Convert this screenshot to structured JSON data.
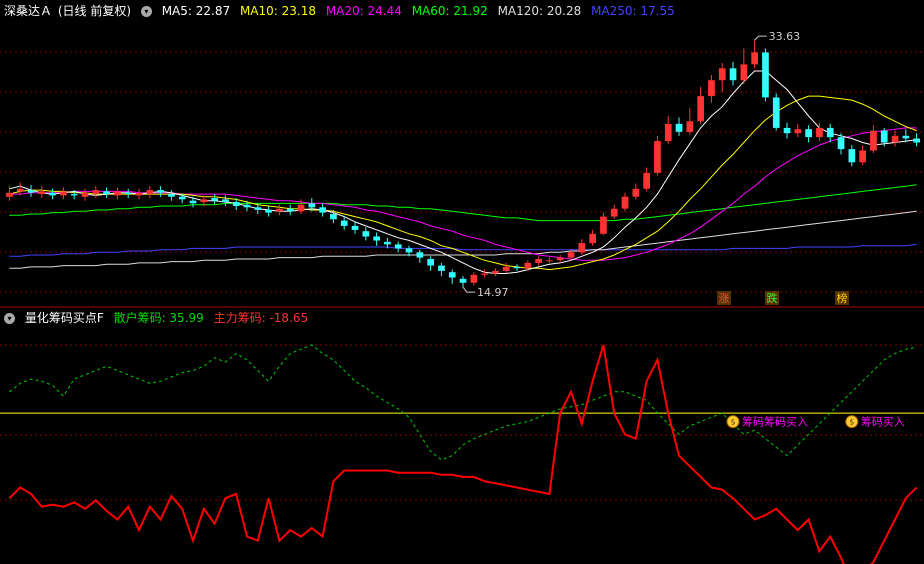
{
  "header_top": {
    "title": "深桑达Ａ",
    "period": "(日线 前复权)",
    "ma": [
      {
        "label": "MA5: 22.87",
        "color": "#ffffff"
      },
      {
        "label": "MA10: 23.18",
        "color": "#ffff00"
      },
      {
        "label": "MA20: 24.44",
        "color": "#ff00ff"
      },
      {
        "label": "MA60: 21.92",
        "color": "#00ff00"
      },
      {
        "label": "MA120: 20.28",
        "color": "#dddddd"
      },
      {
        "label": "MA250: 17.55",
        "color": "#4444ff"
      }
    ]
  },
  "header_bottom": {
    "title": "量化筹码买点F",
    "retail_label": "散户筹码: 35.99",
    "main_label": "主力筹码: -18.65"
  },
  "annotations": {
    "high": "33.63",
    "low": "14.97",
    "buy_label_1": "筹码筹码买入",
    "buy_label_2": "筹码买入"
  },
  "badges": [
    "涨",
    "跌",
    "榜"
  ],
  "colors": {
    "up": "#ff3333",
    "down": "#33ffff",
    "grid": "#8a0000",
    "divider": "#aa0000",
    "ma5": "#ffffff",
    "ma10": "#ffff00",
    "ma20": "#ff00ff",
    "ma60": "#00ff00",
    "ma120": "#dddddd",
    "ma250": "#4444ff",
    "retail": "#00cc00",
    "main": "#ff0000",
    "zero_line": "#ffff00",
    "buy_text": "#ff00ff"
  },
  "chart_data": [
    {
      "type": "candlestick",
      "name": "price",
      "ylim": [
        14,
        35
      ],
      "candles": [
        [
          21.8,
          22.1,
          22.6,
          21.5
        ],
        [
          22.2,
          22.4,
          22.9,
          21.9
        ],
        [
          22.3,
          22.1,
          22.7,
          21.8
        ],
        [
          22.0,
          22.2,
          22.6,
          21.7
        ],
        [
          22.1,
          21.9,
          22.4,
          21.6
        ],
        [
          21.9,
          22.2,
          22.5,
          21.6
        ],
        [
          22.0,
          21.9,
          22.3,
          21.6
        ],
        [
          21.8,
          22.1,
          22.4,
          21.5
        ],
        [
          22.0,
          22.3,
          22.6,
          21.7
        ],
        [
          22.2,
          22.0,
          22.5,
          21.7
        ],
        [
          21.9,
          22.2,
          22.5,
          21.6
        ],
        [
          22.1,
          22.0,
          22.4,
          21.7
        ],
        [
          21.9,
          22.1,
          22.4,
          21.6
        ],
        [
          22.0,
          22.3,
          22.6,
          21.7
        ],
        [
          22.3,
          22.1,
          22.6,
          21.8
        ],
        [
          22.0,
          21.8,
          22.3,
          21.5
        ],
        [
          21.8,
          21.6,
          22.0,
          21.3
        ],
        [
          21.5,
          21.3,
          21.8,
          21.0
        ],
        [
          21.4,
          21.6,
          21.9,
          21.1
        ],
        [
          21.7,
          21.5,
          22.0,
          21.2
        ],
        [
          21.6,
          21.4,
          21.9,
          21.1
        ],
        [
          21.4,
          21.1,
          21.7,
          20.8
        ],
        [
          21.2,
          21.0,
          21.5,
          20.7
        ],
        [
          21.0,
          20.8,
          21.3,
          20.5
        ],
        [
          20.8,
          20.6,
          21.1,
          20.3
        ],
        [
          20.7,
          20.9,
          21.2,
          20.4
        ],
        [
          20.9,
          20.7,
          21.2,
          20.4
        ],
        [
          20.7,
          21.2,
          21.6,
          20.5
        ],
        [
          21.3,
          21.0,
          21.7,
          20.7
        ],
        [
          21.0,
          20.6,
          21.3,
          20.3
        ],
        [
          20.5,
          20.1,
          20.8,
          19.8
        ],
        [
          20.0,
          19.6,
          20.3,
          19.3
        ],
        [
          19.6,
          19.3,
          19.9,
          19.0
        ],
        [
          19.2,
          18.8,
          19.5,
          18.5
        ],
        [
          18.8,
          18.5,
          19.1,
          18.1
        ],
        [
          18.4,
          18.2,
          18.7,
          17.9
        ],
        [
          18.2,
          17.9,
          18.4,
          17.6
        ],
        [
          17.9,
          17.6,
          18.1,
          17.3
        ],
        [
          17.6,
          17.2,
          17.8,
          16.8
        ],
        [
          17.1,
          16.6,
          17.3,
          16.2
        ],
        [
          16.6,
          16.2,
          16.8,
          15.8
        ],
        [
          16.1,
          15.7,
          16.3,
          15.2
        ],
        [
          15.6,
          15.3,
          15.8,
          14.97
        ],
        [
          15.3,
          15.9,
          16.1,
          15.1
        ],
        [
          15.9,
          16.0,
          16.3,
          15.7
        ],
        [
          16.0,
          16.2,
          16.4,
          15.8
        ],
        [
          16.2,
          16.5,
          16.8,
          16.0
        ],
        [
          16.5,
          16.4,
          16.7,
          16.2
        ],
        [
          16.4,
          16.8,
          17.0,
          16.2
        ],
        [
          16.8,
          17.1,
          17.3,
          16.6
        ],
        [
          17.0,
          17.0,
          17.3,
          16.8
        ],
        [
          17.0,
          17.2,
          17.4,
          16.8
        ],
        [
          17.2,
          17.6,
          17.8,
          17.0
        ],
        [
          17.6,
          18.3,
          18.6,
          17.4
        ],
        [
          18.3,
          19.0,
          19.3,
          18.1
        ],
        [
          19.0,
          20.3,
          20.6,
          18.9
        ],
        [
          20.3,
          20.9,
          21.2,
          20.1
        ],
        [
          20.9,
          21.8,
          22.1,
          20.7
        ],
        [
          21.8,
          22.4,
          22.8,
          21.6
        ],
        [
          22.4,
          23.6,
          24.0,
          22.2
        ],
        [
          23.6,
          26.0,
          26.4,
          23.4
        ],
        [
          26.0,
          27.3,
          27.9,
          25.8
        ],
        [
          27.3,
          26.7,
          27.8,
          26.4
        ],
        [
          26.7,
          27.5,
          28.5,
          26.5
        ],
        [
          27.5,
          29.4,
          30.1,
          27.3
        ],
        [
          29.4,
          30.6,
          31.0,
          28.9
        ],
        [
          30.6,
          31.5,
          31.9,
          29.7
        ],
        [
          31.5,
          30.6,
          32.0,
          30.2
        ],
        [
          30.6,
          31.8,
          33.0,
          30.3
        ],
        [
          31.8,
          32.7,
          33.63,
          31.5
        ],
        [
          32.7,
          29.3,
          33.0,
          29.0
        ],
        [
          29.3,
          27.0,
          29.6,
          26.8
        ],
        [
          27.0,
          26.6,
          27.4,
          26.2
        ],
        [
          26.6,
          26.9,
          27.3,
          26.3
        ],
        [
          26.9,
          26.3,
          27.2,
          25.9
        ],
        [
          26.3,
          27.0,
          27.4,
          26.0
        ],
        [
          27.0,
          26.3,
          27.3,
          25.9
        ],
        [
          26.3,
          25.4,
          26.6,
          25.0
        ],
        [
          25.4,
          24.4,
          25.7,
          24.1
        ],
        [
          24.4,
          25.3,
          25.7,
          24.2
        ],
        [
          25.3,
          26.8,
          27.2,
          25.1
        ],
        [
          26.8,
          25.9,
          27.0,
          25.6
        ],
        [
          25.9,
          26.4,
          26.8,
          25.6
        ],
        [
          26.4,
          26.2,
          26.9,
          25.9
        ],
        [
          26.2,
          25.9,
          26.6,
          25.6
        ]
      ],
      "ma5": [
        22.4,
        22.6,
        22.3,
        22.1,
        22.0,
        22.1,
        22.2,
        22.0,
        21.9,
        22.0,
        22.1,
        22.1,
        22.0,
        22.1,
        22.2,
        22.1,
        21.9,
        21.7,
        21.5,
        21.5,
        21.4,
        21.3,
        21.1,
        20.9,
        20.8,
        20.7,
        20.7,
        20.8,
        20.9,
        20.8,
        20.6,
        20.3,
        19.9,
        19.6,
        19.3,
        19.0,
        18.7,
        18.5,
        18.2,
        17.9,
        17.6,
        17.2,
        16.8,
        16.4,
        16.1,
        16.0,
        16.0,
        16.1,
        16.3,
        16.5,
        16.7,
        16.8,
        17.0,
        17.3,
        17.6,
        18.0,
        18.7,
        19.5,
        20.2,
        21.0,
        22.0,
        23.3,
        24.6,
        25.8,
        27.0,
        27.9,
        28.6,
        29.6,
        30.5,
        31.3,
        31.3,
        30.6,
        29.9,
        28.9,
        27.9,
        27.0,
        26.6,
        26.4,
        26.2,
        25.9,
        25.7,
        25.8,
        25.9,
        26.0,
        26.1
      ],
      "ma10": [
        22.0,
        22.2,
        22.3,
        22.3,
        22.2,
        22.2,
        22.1,
        22.1,
        22.0,
        22.0,
        22.0,
        22.0,
        22.0,
        22.0,
        22.0,
        22.0,
        22.0,
        21.9,
        21.8,
        21.8,
        21.7,
        21.6,
        21.4,
        21.2,
        21.1,
        21.0,
        20.9,
        20.9,
        20.8,
        20.8,
        20.7,
        20.5,
        20.3,
        20.1,
        19.9,
        19.6,
        19.3,
        19.0,
        18.8,
        18.5,
        18.1,
        17.9,
        17.6,
        17.3,
        17.0,
        16.8,
        16.6,
        16.5,
        16.4,
        16.4,
        16.3,
        16.4,
        16.5,
        16.7,
        16.9,
        17.1,
        17.4,
        17.8,
        18.2,
        18.7,
        19.2,
        19.9,
        20.7,
        21.6,
        22.4,
        23.3,
        24.2,
        25.0,
        25.9,
        26.8,
        27.6,
        28.2,
        28.7,
        29.1,
        29.4,
        29.4,
        29.3,
        29.2,
        29.1,
        28.8,
        28.4,
        27.9,
        27.5,
        27.1,
        26.8
      ],
      "ma20": [
        22.0,
        22.0,
        22.1,
        22.1,
        22.1,
        22.1,
        22.2,
        22.2,
        22.2,
        22.2,
        22.2,
        22.2,
        22.1,
        22.1,
        22.1,
        22.1,
        22.0,
        22.0,
        22.0,
        22.0,
        22.0,
        21.9,
        21.8,
        21.7,
        21.6,
        21.5,
        21.5,
        21.4,
        21.3,
        21.3,
        21.2,
        21.1,
        21.0,
        20.8,
        20.7,
        20.5,
        20.3,
        20.1,
        19.9,
        19.6,
        19.4,
        19.2,
        18.9,
        18.7,
        18.5,
        18.2,
        18.0,
        17.8,
        17.6,
        17.4,
        17.3,
        17.2,
        17.1,
        17.0,
        17.0,
        17.0,
        17.1,
        17.2,
        17.4,
        17.6,
        17.9,
        18.2,
        18.6,
        19.0,
        19.5,
        20.1,
        20.7,
        21.3,
        22.0,
        22.6,
        23.3,
        23.9,
        24.4,
        24.9,
        25.3,
        25.7,
        26.0,
        26.2,
        26.4,
        26.6,
        26.7,
        26.8,
        26.9,
        27.0,
        27.0
      ],
      "ma60": [
        20.4,
        20.4,
        20.5,
        20.5,
        20.6,
        20.6,
        20.7,
        20.7,
        20.8,
        20.8,
        20.9,
        20.9,
        21.0,
        21.0,
        21.1,
        21.1,
        21.1,
        21.2,
        21.2,
        21.2,
        21.3,
        21.3,
        21.3,
        21.3,
        21.3,
        21.3,
        21.3,
        21.3,
        21.3,
        21.3,
        21.3,
        21.2,
        21.2,
        21.2,
        21.1,
        21.1,
        21.0,
        21.0,
        20.9,
        20.9,
        20.8,
        20.7,
        20.6,
        20.5,
        20.4,
        20.3,
        20.2,
        20.2,
        20.1,
        20.0,
        20.0,
        20.0,
        20.0,
        20.0,
        20.0,
        20.0,
        20.0,
        20.1,
        20.1,
        20.2,
        20.3,
        20.4,
        20.5,
        20.6,
        20.7,
        20.8,
        20.9,
        21.0,
        21.1,
        21.2,
        21.3,
        21.4,
        21.5,
        21.6,
        21.7,
        21.8,
        21.9,
        22.0,
        22.1,
        22.2,
        22.3,
        22.4,
        22.5,
        22.6,
        22.7
      ],
      "ma120": [
        16.4,
        16.4,
        16.5,
        16.5,
        16.5,
        16.6,
        16.6,
        16.6,
        16.6,
        16.7,
        16.7,
        16.7,
        16.8,
        16.8,
        16.8,
        16.9,
        16.9,
        16.9,
        17.0,
        17.0,
        17.0,
        17.1,
        17.1,
        17.1,
        17.1,
        17.2,
        17.2,
        17.2,
        17.2,
        17.3,
        17.3,
        17.3,
        17.3,
        17.3,
        17.4,
        17.4,
        17.4,
        17.4,
        17.4,
        17.4,
        17.4,
        17.4,
        17.4,
        17.4,
        17.4,
        17.4,
        17.5,
        17.5,
        17.5,
        17.5,
        17.6,
        17.6,
        17.7,
        17.7,
        17.8,
        17.8,
        17.9,
        18.0,
        18.1,
        18.2,
        18.3,
        18.4,
        18.5,
        18.6,
        18.7,
        18.8,
        18.9,
        19.0,
        19.1,
        19.2,
        19.3,
        19.4,
        19.5,
        19.6,
        19.7,
        19.8,
        19.9,
        20.0,
        20.1,
        20.2,
        20.3,
        20.4,
        20.5,
        20.6,
        20.7
      ],
      "ma250": [
        17.3,
        17.3,
        17.4,
        17.4,
        17.4,
        17.5,
        17.5,
        17.5,
        17.6,
        17.6,
        17.6,
        17.7,
        17.7,
        17.7,
        17.8,
        17.8,
        17.8,
        17.9,
        17.9,
        17.9,
        17.9,
        18.0,
        18.0,
        18.0,
        18.0,
        18.0,
        18.0,
        18.0,
        18.0,
        18.0,
        18.0,
        18.0,
        18.0,
        18.0,
        18.0,
        18.0,
        17.9,
        17.9,
        17.9,
        17.9,
        17.9,
        17.9,
        17.8,
        17.8,
        17.8,
        17.8,
        17.8,
        17.8,
        17.8,
        17.8,
        17.8,
        17.8,
        17.8,
        17.8,
        17.8,
        17.8,
        17.8,
        17.8,
        17.8,
        17.8,
        17.8,
        17.8,
        17.8,
        17.8,
        17.8,
        17.8,
        17.8,
        17.9,
        17.9,
        17.9,
        17.9,
        17.9,
        17.9,
        18.0,
        18.0,
        18.0,
        18.0,
        18.0,
        18.0,
        18.1,
        18.1,
        18.1,
        18.1,
        18.1,
        18.2
      ]
    },
    {
      "type": "line",
      "name": "indicator",
      "ylim": [
        -40,
        70
      ],
      "series": [
        {
          "name": "散户筹码",
          "values": [
            40,
            44,
            46,
            45,
            43,
            38,
            46,
            48,
            50,
            52,
            50,
            48,
            46,
            44,
            45,
            47,
            49,
            50,
            52,
            56,
            54,
            58,
            55,
            50,
            45,
            52,
            58,
            60,
            62,
            58,
            55,
            50,
            45,
            42,
            38,
            35,
            32,
            28,
            20,
            12,
            8,
            10,
            15,
            18,
            20,
            22,
            24,
            25,
            26,
            28,
            30,
            32,
            33,
            34,
            36,
            38,
            40,
            40,
            38,
            36,
            30,
            25,
            20,
            24,
            26,
            28,
            30,
            25,
            20,
            22,
            18,
            14,
            10,
            15,
            20,
            25,
            30,
            35,
            40,
            45,
            50,
            55,
            58,
            60,
            61
          ]
        },
        {
          "name": "主力筹码",
          "values": [
            -10,
            -5,
            -8,
            -14,
            -13,
            -14,
            -12,
            -15,
            -11,
            -16,
            -20,
            -14,
            -25,
            -14,
            -20,
            -9,
            -15,
            -30,
            -15,
            -22,
            -10,
            -8,
            -28,
            -30,
            -10,
            -30,
            -25,
            -28,
            -24,
            -28,
            -2,
            3,
            3,
            3,
            3,
            3,
            2,
            2,
            2,
            2,
            1,
            1,
            0,
            0,
            -2,
            -3,
            -4,
            -5,
            -6,
            -7,
            -8,
            30,
            40,
            25,
            45,
            62,
            30,
            20,
            18,
            45,
            55,
            30,
            10,
            5,
            0,
            -5,
            -6,
            -10,
            -15,
            -20,
            -18,
            -15,
            -20,
            -25,
            -20,
            -35,
            -28,
            -38,
            -50,
            -45,
            -40,
            -30,
            -20,
            -10,
            -5
          ]
        }
      ],
      "buy_signals": [
        {
          "index": 67,
          "label": "筹码筹码买入"
        },
        {
          "index": 78,
          "label": "筹码买入"
        }
      ]
    }
  ]
}
